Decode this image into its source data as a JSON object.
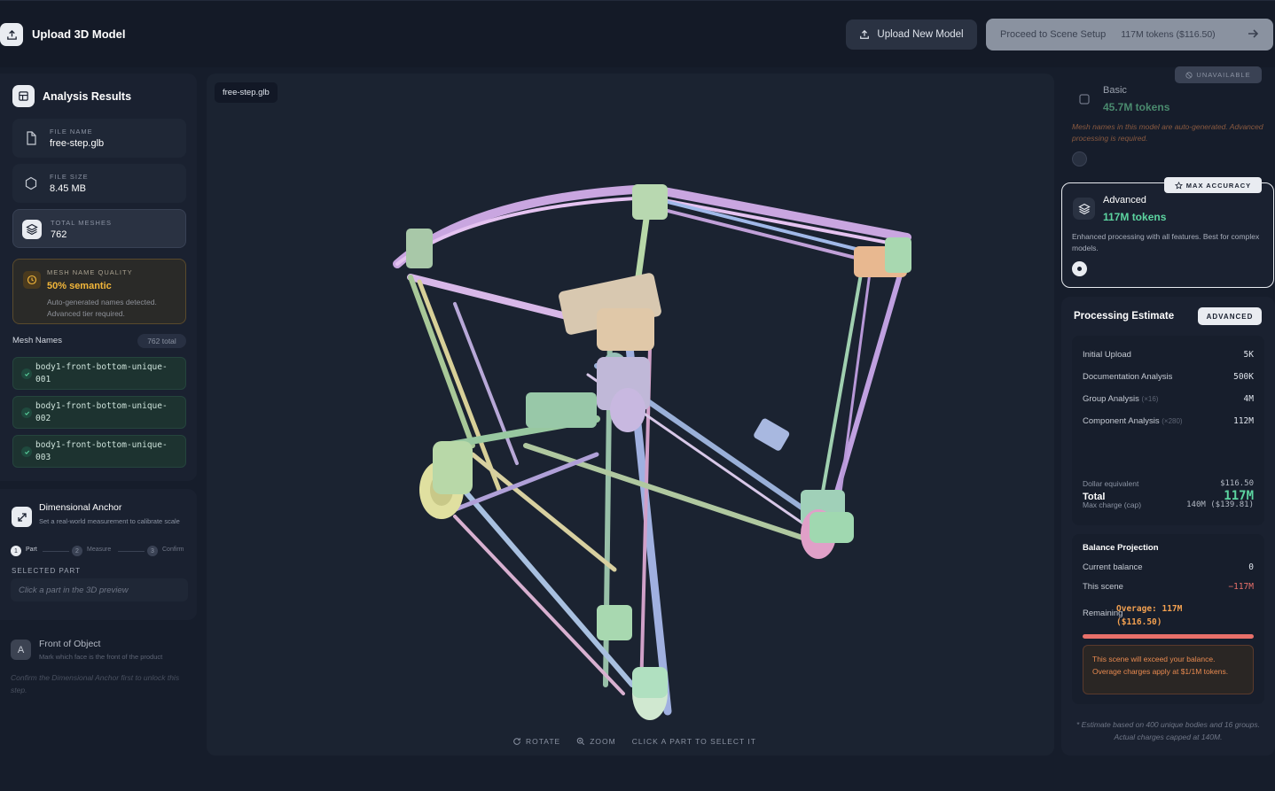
{
  "header": {
    "title": "Upload 3D Model",
    "upload_btn": "Upload New Model",
    "proceed_btn": "Proceed to Scene Setup",
    "proceed_tokens": "117M tokens ($116.50)"
  },
  "analysis": {
    "title": "Analysis Results",
    "file_name_label": "FILE NAME",
    "file_name": "free-step.glb",
    "file_size_label": "FILE SIZE",
    "file_size": "8.45 MB",
    "total_meshes_label": "TOTAL MESHES",
    "total_meshes": "762",
    "quality_label": "MESH NAME QUALITY",
    "quality_value": "50% semantic",
    "quality_desc": "Auto-generated names detected. Advanced tier required.",
    "mesh_names_label": "Mesh Names",
    "mesh_total": "762 total",
    "meshes": [
      "body1-front-bottom-unique-001",
      "body1-front-bottom-unique-002",
      "body1-front-bottom-unique-003"
    ]
  },
  "anchor": {
    "title": "Dimensional Anchor",
    "desc": "Set a real-world measurement to calibrate scale",
    "steps": [
      {
        "num": "1",
        "label": "Part"
      },
      {
        "num": "2",
        "label": "Measure"
      },
      {
        "num": "3",
        "label": "Confirm"
      }
    ],
    "selected_label": "SELECTED PART",
    "selected_placeholder": "Click a part in the 3D preview"
  },
  "front": {
    "letter": "A",
    "title": "Front of Object",
    "desc": "Mark which face is the front of the product",
    "note": "Confirm the Dimensional Anchor first to unlock this step."
  },
  "viewer": {
    "file_chip": "free-step.glb",
    "hint_rotate": "ROTATE",
    "hint_zoom": "ZOOM",
    "hint_click": "CLICK A PART TO SELECT IT"
  },
  "tiers": {
    "unavailable": "UNAVAILABLE",
    "basic_name": "Basic",
    "basic_tokens": "45.7M tokens",
    "basic_warning": "Mesh names in this model are auto-generated. Advanced processing is required.",
    "max_accuracy": "MAX ACCURACY",
    "advanced_name": "Advanced",
    "advanced_tokens": "117M tokens",
    "advanced_desc": "Enhanced processing with all features. Best for complex models."
  },
  "estimate": {
    "title": "Processing Estimate",
    "badge": "ADVANCED",
    "rows": [
      {
        "label": "Initial Upload",
        "extra": "",
        "value": "5K"
      },
      {
        "label": "Documentation Analysis",
        "extra": "",
        "value": "500K"
      },
      {
        "label": "Group Analysis",
        "extra": "(×16)",
        "value": "4M"
      },
      {
        "label": "Component Analysis",
        "extra": "(×280)",
        "value": "112M"
      }
    ],
    "total_label": "Total",
    "total_value": "117M",
    "dollar_label": "Dollar equivalent",
    "dollar_value": "$116.50",
    "max_label": "Max charge (cap)",
    "max_value": "140M ($139.81)",
    "balance_title": "Balance Projection",
    "current_label": "Current balance",
    "current_value": "0",
    "scene_label": "This scene",
    "scene_value": "−117M",
    "remaining_label": "Remaining",
    "overage_line1": "Overage: 117M",
    "overage_line2": "($116.50)",
    "warning": "This scene will exceed your balance. Overage charges apply at $1/1M tokens.",
    "footnote": "* Estimate based on 400 unique bodies and 16 groups. Actual charges capped at 140M."
  },
  "colors": {
    "accent_green": "#5cd4a0",
    "warning_orange": "#f2a050",
    "quality_amber": "#f2b63a",
    "bar_red": "#e8706a"
  }
}
